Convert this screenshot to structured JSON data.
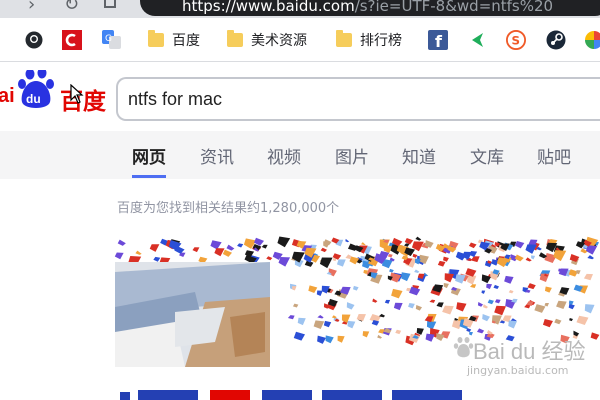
{
  "browser": {
    "url_prefix": "https://www.baidu.com",
    "url_rest": "/s?ie=UTF-8&wd=ntfs%20",
    "bookmarks": [
      {
        "icon": "github-icon",
        "label": ""
      },
      {
        "icon": "red-c-icon",
        "label": ""
      },
      {
        "icon": "google-translate-icon",
        "label": ""
      },
      {
        "icon": "folder-icon",
        "label": "百度"
      },
      {
        "icon": "folder-icon",
        "label": "美术资源"
      },
      {
        "icon": "folder-icon",
        "label": "排行榜"
      },
      {
        "icon": "facebook-icon",
        "label": ""
      },
      {
        "icon": "green-arrow-icon",
        "label": ""
      },
      {
        "icon": "orange-s-icon",
        "label": ""
      },
      {
        "icon": "steam-icon",
        "label": ""
      },
      {
        "icon": "photos-icon",
        "label": ""
      }
    ]
  },
  "baidu": {
    "logo_text": "百度",
    "search_value": "ntfs for mac",
    "tabs": [
      "网页",
      "资讯",
      "视频",
      "图片",
      "知道",
      "文库",
      "贴吧"
    ],
    "active_tab": 0,
    "result_count": "百度为您找到相关结果约1,280,000个"
  },
  "watermark": {
    "main": "Bai du 经验",
    "sub": "jingyan.baidu.com"
  },
  "colors": {
    "baidu_red": "#e10602",
    "baidu_blue": "#2932e1",
    "tab_accent": "#4e6ef2"
  }
}
